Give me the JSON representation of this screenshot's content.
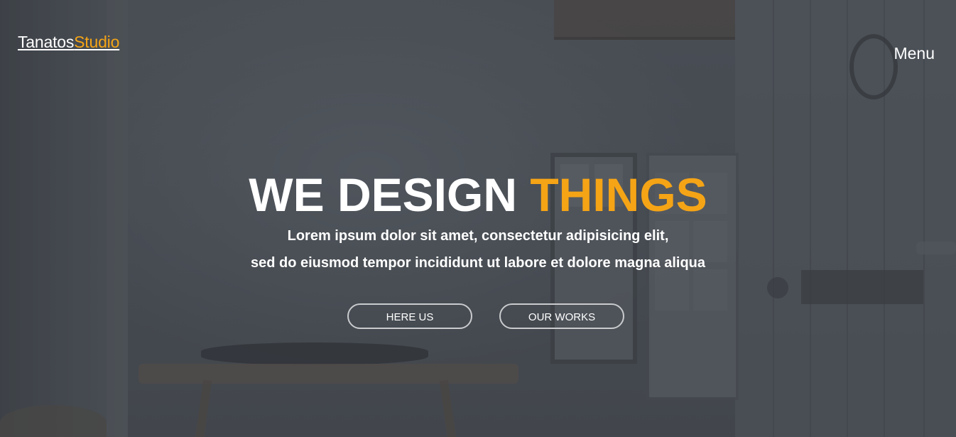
{
  "header": {
    "logo_primary": "Tanatos",
    "logo_accent": "Studio",
    "menu_label": "Menu"
  },
  "hero": {
    "headline_main": "WE DESIGN",
    "headline_accent": "THINGS",
    "subtitle_line1": "Lorem ipsum dolor sit amet, consectetur adipisicing elit,",
    "subtitle_line2": "sed do eiusmod tempor incididunt ut labore et dolore magna aliqua",
    "buttons": [
      {
        "label": "HERE US"
      },
      {
        "label": "OUR WORKS"
      }
    ]
  },
  "colors": {
    "accent": "#f5a416",
    "text": "#ffffff",
    "overlay": "#4a4f55"
  }
}
